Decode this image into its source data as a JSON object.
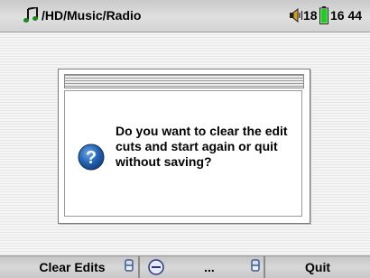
{
  "status_bar": {
    "music_icon": "music-note-icon",
    "path": "/HD/Music/Radio",
    "speaker_icon": "speaker-icon",
    "volume": "18",
    "battery_icon": "battery-icon",
    "battery_color": "#22cc22",
    "time": "16 44"
  },
  "dialog": {
    "icon": "question-icon",
    "icon_color": "#1f5fb0",
    "message": "Do you want to clear the edit cuts and start again or quit without saving?"
  },
  "softkeys": {
    "left_label": "Clear Edits",
    "left_key_icon": "softkey-left-icon",
    "middle_icon": "menu-icon",
    "middle_label": "...",
    "right_key_icon": "softkey-right-icon",
    "right_label": "Quit"
  }
}
